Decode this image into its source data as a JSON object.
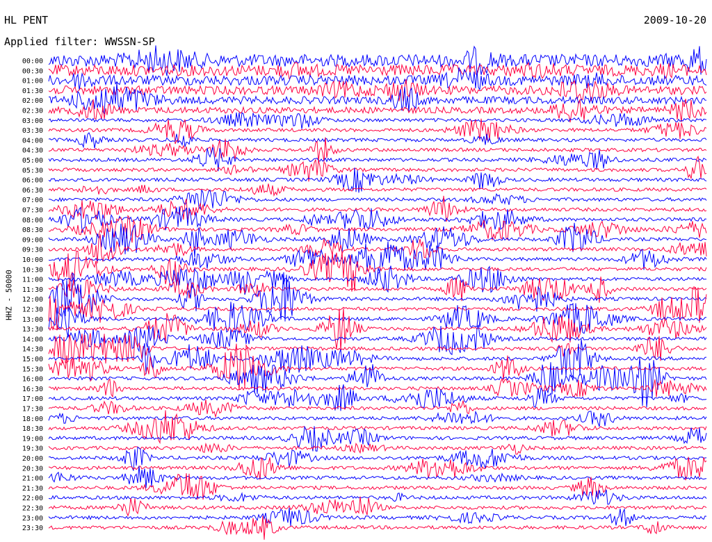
{
  "header": {
    "station": "HL PENT",
    "date": "2009-10-20",
    "filter": "Applied filter: WWSSN-SP"
  },
  "chart_data": {
    "type": "line",
    "title": "HL PENT",
    "date": "2009-10-20",
    "filter": "Applied filter: WWSSN-SP",
    "ylabel": "HHZ - 50000",
    "rows": [
      "00:00",
      "00:30",
      "01:00",
      "01:30",
      "02:00",
      "02:30",
      "03:00",
      "03:30",
      "04:00",
      "04:30",
      "05:00",
      "05:30",
      "06:00",
      "06:30",
      "07:00",
      "07:30",
      "08:00",
      "08:30",
      "09:00",
      "09:30",
      "10:00",
      "10:30",
      "11:00",
      "11:30",
      "12:00",
      "12:30",
      "13:00",
      "13:30",
      "14:00",
      "14:30",
      "15:00",
      "15:30",
      "16:00",
      "16:30",
      "17:00",
      "17:30",
      "18:00",
      "18:30",
      "19:00",
      "19:30",
      "20:00",
      "20:30",
      "21:00",
      "21:30",
      "22:00",
      "22:30",
      "23:00",
      "23:30"
    ],
    "colors": [
      "#0000ff",
      "#ff0040"
    ],
    "grid": false,
    "legend": "none"
  }
}
